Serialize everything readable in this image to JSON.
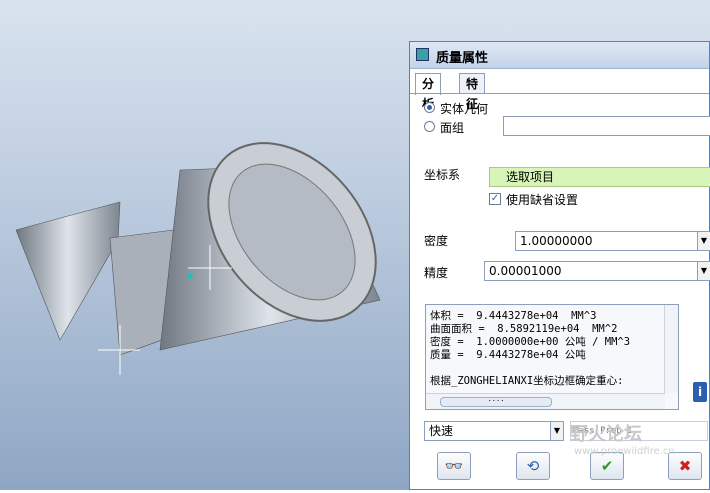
{
  "dialog": {
    "title": "质量属性",
    "tabs": [
      {
        "label": "分析"
      },
      {
        "label": "特征"
      }
    ],
    "geometry_options": [
      {
        "label": "实体几何",
        "selected": true
      },
      {
        "label": "面组",
        "selected": false
      }
    ],
    "coord_label": "坐标系",
    "coord_select": "选取项目",
    "default_setting": "使用缺省设置",
    "density_label": "密度",
    "density_value": "1.00000000",
    "precision_label": "精度",
    "precision_value": "0.00001000",
    "results": {
      "lines": [
        "体积 =  9.4443278e+04  MM^3",
        "曲面面积 =  8.5892119e+04  MM^2",
        "密度 =  1.0000000e+00 公吨 / MM^3",
        "质量 =  9.4443278e+04 公吨",
        "",
        "根据_ZONGHELIANXI坐标边框确定重心:"
      ]
    },
    "mode": "快速",
    "name_placeholder": "Mass Prop 1",
    "scroll_thumb": "····"
  },
  "watermark": {
    "text": "野火论坛",
    "url": "www.proewildfire.cn"
  },
  "colors": {
    "accent": "#2b5fb0",
    "select_bg": "#d8f5b8",
    "ok": "#2c9a2c",
    "cancel": "#cc2222"
  },
  "icons": {
    "info": "info-icon",
    "glasses": "glasses-icon",
    "repeat": "repeat-icon",
    "ok": "checkmark-icon",
    "cancel": "close-icon"
  }
}
